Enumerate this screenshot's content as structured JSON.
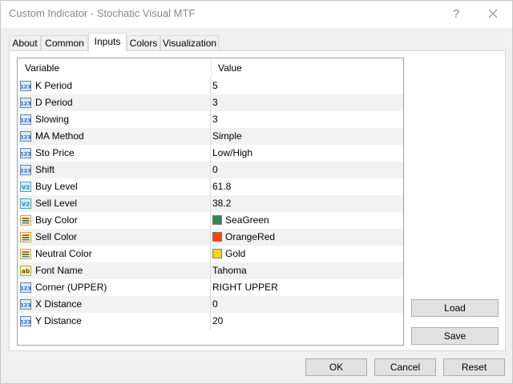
{
  "window": {
    "title": "Custom Indicator - Stochatic Visual MTF",
    "help_label": "?",
    "close_icon": "close-icon"
  },
  "tabs": [
    {
      "label": "About",
      "active": false
    },
    {
      "label": "Common",
      "active": false
    },
    {
      "label": "Inputs",
      "active": true
    },
    {
      "label": "Colors",
      "active": false
    },
    {
      "label": "Visualization",
      "active": false
    }
  ],
  "grid": {
    "headers": {
      "variable": "Variable",
      "value": "Value"
    },
    "rows": [
      {
        "icon": "integer-icon",
        "variable": "K Period",
        "value": "5"
      },
      {
        "icon": "integer-icon",
        "variable": "D Period",
        "value": "3"
      },
      {
        "icon": "integer-icon",
        "variable": "Slowing",
        "value": "3"
      },
      {
        "icon": "integer-icon",
        "variable": "MA Method",
        "value": "Simple"
      },
      {
        "icon": "integer-icon",
        "variable": "Sto Price",
        "value": "Low/High"
      },
      {
        "icon": "integer-icon",
        "variable": "Shift",
        "value": "0"
      },
      {
        "icon": "double-icon",
        "variable": "Buy Level",
        "value": "61.8"
      },
      {
        "icon": "double-icon",
        "variable": "Sell Level",
        "value": "38.2"
      },
      {
        "icon": "color-icon",
        "variable": "Buy Color",
        "value": "SeaGreen",
        "swatch": "#2e8b57"
      },
      {
        "icon": "color-icon",
        "variable": "Sell Color",
        "value": "OrangeRed",
        "swatch": "#ff4500"
      },
      {
        "icon": "color-icon",
        "variable": "Neutral Color",
        "value": "Gold",
        "swatch": "#ffd700"
      },
      {
        "icon": "string-icon",
        "variable": "Font Name",
        "value": "Tahoma"
      },
      {
        "icon": "integer-icon",
        "variable": "Corner (UPPER)",
        "value": "RIGHT UPPER"
      },
      {
        "icon": "integer-icon",
        "variable": "X Distance",
        "value": "0"
      },
      {
        "icon": "integer-icon",
        "variable": "Y Distance",
        "value": "20"
      }
    ]
  },
  "side_buttons": {
    "load": "Load",
    "save": "Save"
  },
  "footer": {
    "ok": "OK",
    "cancel": "Cancel",
    "reset": "Reset"
  }
}
